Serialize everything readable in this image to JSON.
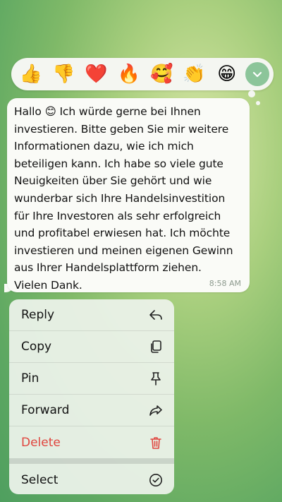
{
  "reactions": [
    {
      "emoji": "👍",
      "name": "thumbs-up"
    },
    {
      "emoji": "👎",
      "name": "thumbs-down"
    },
    {
      "emoji": "❤️",
      "name": "heart"
    },
    {
      "emoji": "🔥",
      "name": "fire"
    },
    {
      "emoji": "🥰",
      "name": "smiling-face-with-hearts"
    },
    {
      "emoji": "👏",
      "name": "clapping-hands"
    },
    {
      "emoji": "😁",
      "name": "beaming-face"
    }
  ],
  "message": {
    "text": "Hallo 😊 Ich würde gerne bei Ihnen\ninvestieren. Bitte geben Sie mir weitere\nInformationen dazu, wie ich mich\nbeteiligen kann. Ich habe so viele gute\nNeuigkeiten über Sie gehört und wie\nwunderbar sich Ihre Handelsinvestition\nfür Ihre Investoren als sehr erfolgreich\nund profitabel erwiesen hat. Ich möchte\ninvestieren und meinen eigenen Gewinn\naus Ihrer Handelsplattform ziehen.\nVielen Dank.",
    "time": "8:58 AM"
  },
  "menu": {
    "reply": "Reply",
    "copy": "Copy",
    "pin": "Pin",
    "forward": "Forward",
    "delete": "Delete",
    "select": "Select"
  },
  "colors": {
    "delete": "#e0463f",
    "expand_button": "#8cc59a",
    "bubble": "#fafbf7"
  }
}
